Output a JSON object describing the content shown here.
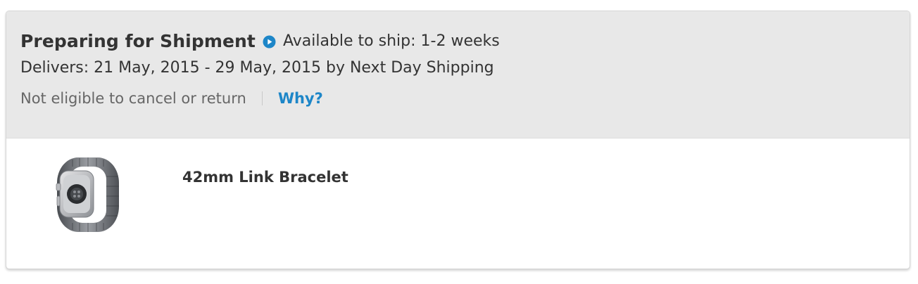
{
  "order": {
    "status_title": "Preparing for Shipment",
    "status_icon": "play-circle-icon",
    "availability": "Available to ship: 1-2 weeks",
    "delivery": "Delivers: 21 May, 2015 - 29 May, 2015 by Next Day Shipping",
    "policy_text": "Not eligible to cancel or return",
    "why_link": "Why?",
    "accent_color": "#1d86c8"
  },
  "item": {
    "name": "42mm Link Bracelet",
    "image_icon": "watch-link-bracelet-image"
  }
}
